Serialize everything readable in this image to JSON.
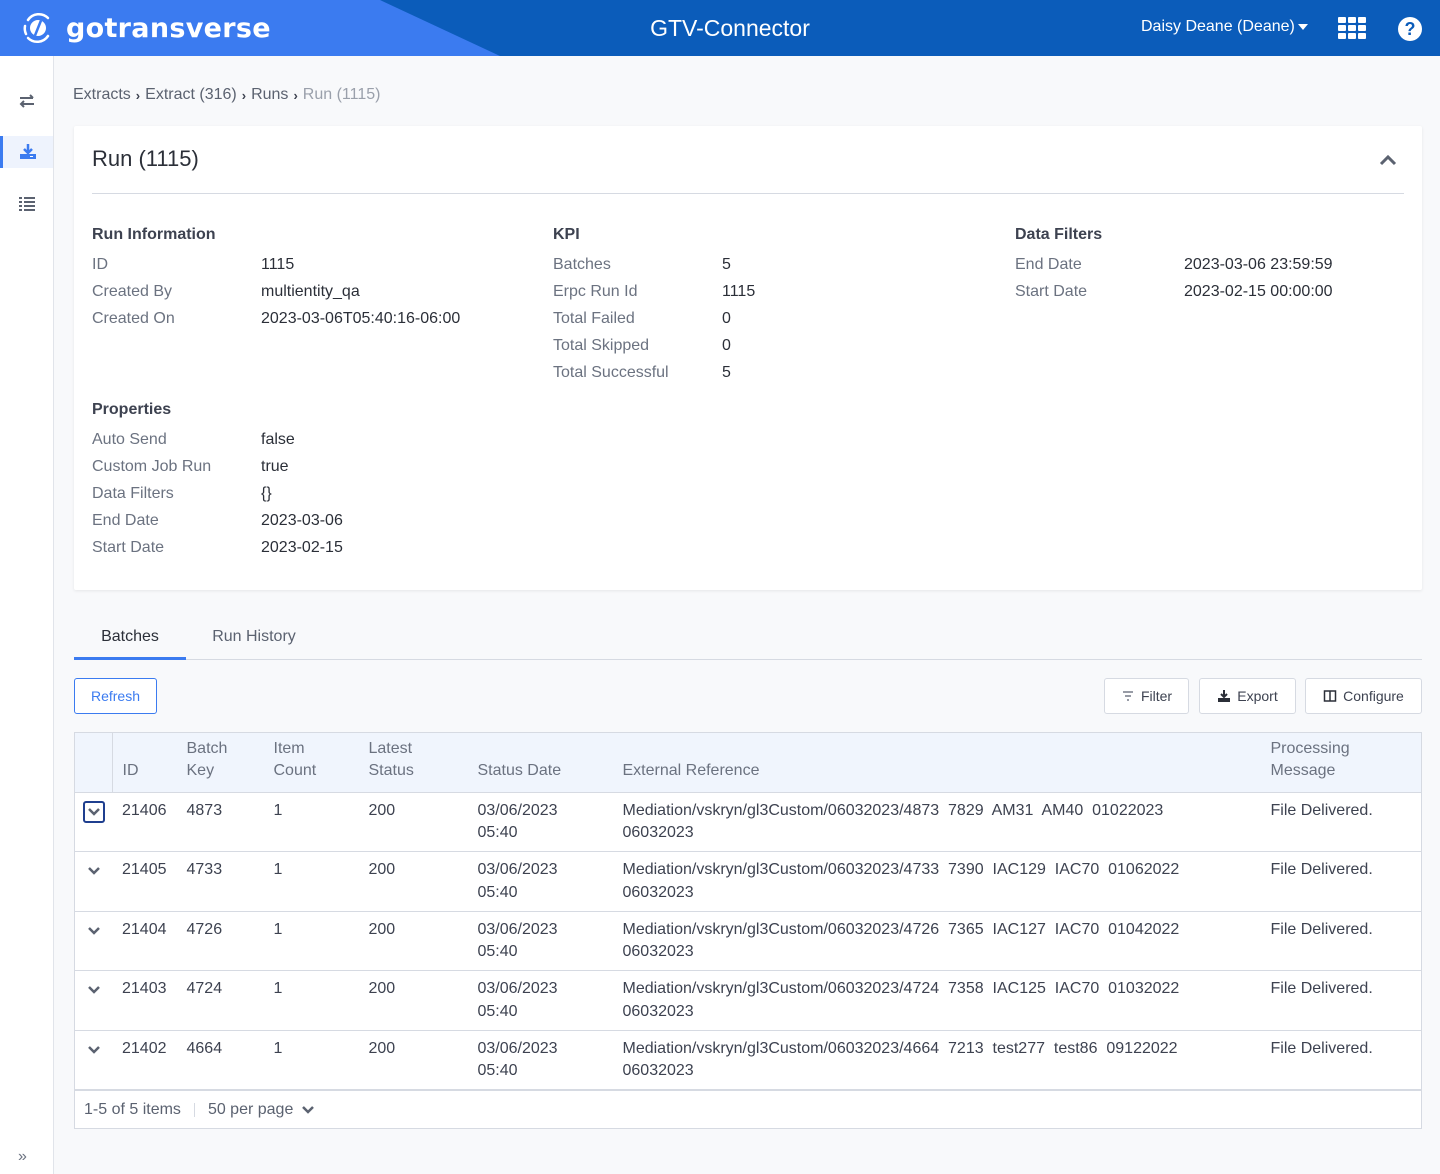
{
  "header": {
    "brand": "gotransverse",
    "app_title": "GTV-Connector",
    "user": "Daisy Deane (Deane)",
    "icons": [
      "apps-grid-icon",
      "help-icon"
    ],
    "help_glyph": "?"
  },
  "sidebar": {
    "items": [
      {
        "name": "transfers",
        "icon": "swap-arrows-icon",
        "active": false
      },
      {
        "name": "extracts",
        "icon": "download-tray-icon",
        "active": true
      },
      {
        "name": "list",
        "icon": "list-icon",
        "active": false
      }
    ],
    "expand_glyph": "»"
  },
  "breadcrumb": {
    "items": [
      "Extracts",
      "Extract (316)",
      "Runs"
    ],
    "current": "Run (1115)",
    "separator": "›"
  },
  "card": {
    "title": "Run (1115)",
    "run_information": {
      "heading": "Run Information",
      "rows": [
        {
          "label": "ID",
          "value": "1115"
        },
        {
          "label": "Created By",
          "value": "multientity_qa"
        },
        {
          "label": "Created On",
          "value": "2023-03-06T05:40:16-06:00"
        }
      ]
    },
    "kpi": {
      "heading": "KPI",
      "rows": [
        {
          "label": "Batches",
          "value": "5"
        },
        {
          "label": "Erpc Run Id",
          "value": "1115"
        },
        {
          "label": "Total Failed",
          "value": "0"
        },
        {
          "label": "Total Skipped",
          "value": "0"
        },
        {
          "label": "Total Successful",
          "value": "5"
        }
      ]
    },
    "data_filters": {
      "heading": "Data Filters",
      "rows": [
        {
          "label": "End Date",
          "value": "2023-03-06 23:59:59"
        },
        {
          "label": "Start Date",
          "value": "2023-02-15 00:00:00"
        }
      ]
    },
    "properties": {
      "heading": "Properties",
      "rows": [
        {
          "label": "Auto Send",
          "value": "false"
        },
        {
          "label": "Custom Job Run",
          "value": "true"
        },
        {
          "label": "Data Filters",
          "value": "{}"
        },
        {
          "label": "End Date",
          "value": "2023-03-06"
        },
        {
          "label": "Start Date",
          "value": "2023-02-15"
        }
      ]
    }
  },
  "tabs": [
    {
      "label": "Batches",
      "active": true
    },
    {
      "label": "Run History",
      "active": false
    }
  ],
  "toolbar": {
    "refresh": "Refresh",
    "filter": "Filter",
    "export": "Export",
    "configure": "Configure"
  },
  "table": {
    "headers": {
      "id": "ID",
      "batch_key_1": "Batch",
      "batch_key_2": "Key",
      "item_count_1": "Item",
      "item_count_2": "Count",
      "latest_status_1": "Latest",
      "latest_status_2": "Status",
      "status_date": "Status Date",
      "external_reference": "External Reference",
      "processing_message_1": "Processing",
      "processing_message_2": "Message"
    },
    "rows": [
      {
        "id": "21406",
        "batch_key": "4873",
        "item_count": "1",
        "latest_status": "200",
        "status_date": "03/06/2023",
        "status_time": "05:40",
        "external_reference": "Mediation/vskryn/gl3Custom/06032023/4873  7829  AM31  AM40  01022023",
        "external_reference_2": "06032023",
        "processing_message": "File Delivered."
      },
      {
        "id": "21405",
        "batch_key": "4733",
        "item_count": "1",
        "latest_status": "200",
        "status_date": "03/06/2023",
        "status_time": "05:40",
        "external_reference": "Mediation/vskryn/gl3Custom/06032023/4733  7390  IAC129  IAC70  01062022",
        "external_reference_2": "06032023",
        "processing_message": "File Delivered."
      },
      {
        "id": "21404",
        "batch_key": "4726",
        "item_count": "1",
        "latest_status": "200",
        "status_date": "03/06/2023",
        "status_time": "05:40",
        "external_reference": "Mediation/vskryn/gl3Custom/06032023/4726  7365  IAC127  IAC70  01042022",
        "external_reference_2": "06032023",
        "processing_message": "File Delivered."
      },
      {
        "id": "21403",
        "batch_key": "4724",
        "item_count": "1",
        "latest_status": "200",
        "status_date": "03/06/2023",
        "status_time": "05:40",
        "external_reference": "Mediation/vskryn/gl3Custom/06032023/4724  7358  IAC125  IAC70  01032022",
        "external_reference_2": "06032023",
        "processing_message": "File Delivered."
      },
      {
        "id": "21402",
        "batch_key": "4664",
        "item_count": "1",
        "latest_status": "200",
        "status_date": "03/06/2023",
        "status_time": "05:40",
        "external_reference": "Mediation/vskryn/gl3Custom/06032023/4664  7213  test277  test86  09122022",
        "external_reference_2": "06032023",
        "processing_message": "File Delivered."
      }
    ],
    "footer": {
      "range": "1-5 of 5 items",
      "page_size": "50 per page"
    }
  },
  "colors": {
    "brand_blue": "#3b7bf0",
    "header_dark": "#0b5cba",
    "accent": "#3b7bf0"
  }
}
